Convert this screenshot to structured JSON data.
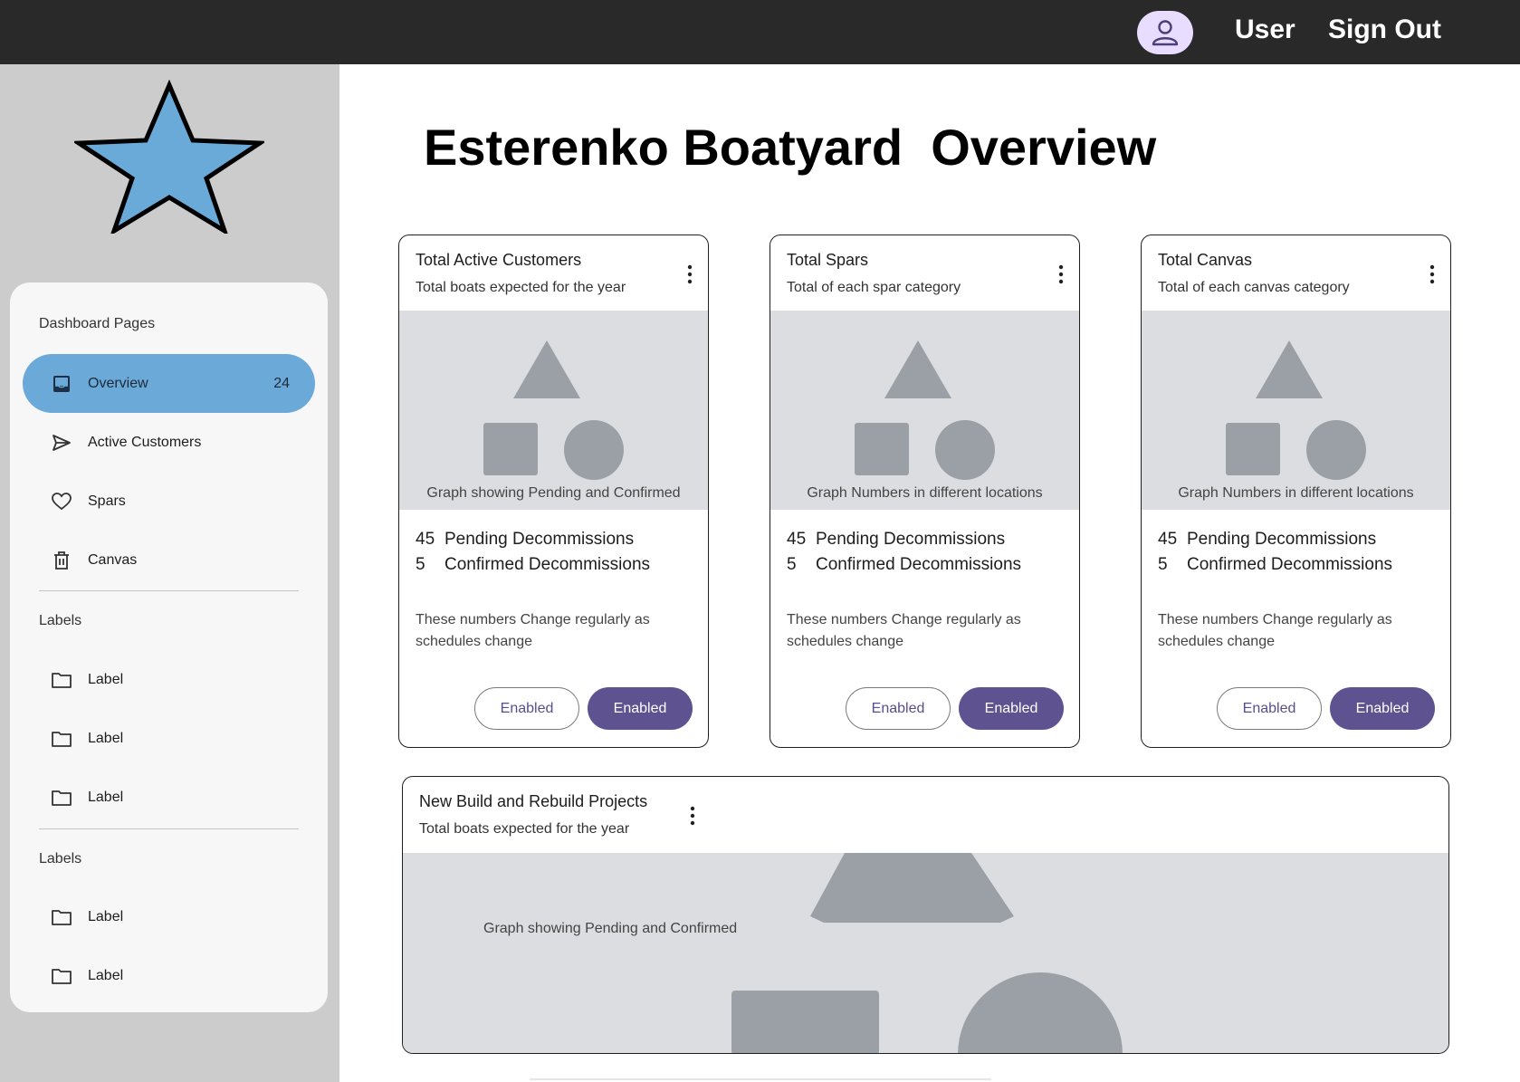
{
  "topbar": {
    "avatar_icon": "person-icon",
    "user_label": "User",
    "signout_label": "Sign Out"
  },
  "sidebar": {
    "logo_icon": "star-icon",
    "logo_color": "#6aaad8",
    "section_title": "Dashboard Pages",
    "pages": [
      {
        "label": "Overview",
        "icon": "inbox-icon",
        "badge": "24",
        "active": true
      },
      {
        "label": "Active Customers",
        "icon": "send-icon"
      },
      {
        "label": "Spars",
        "icon": "heart-icon"
      },
      {
        "label": "Canvas",
        "icon": "trash-icon"
      }
    ],
    "labels_group_1": {
      "title": "Labels",
      "items": [
        {
          "label": "Label",
          "icon": "folder-icon"
        },
        {
          "label": "Label",
          "icon": "folder-icon"
        },
        {
          "label": "Label",
          "icon": "folder-icon"
        }
      ]
    },
    "labels_group_2": {
      "title": "Labels",
      "items": [
        {
          "label": "Label",
          "icon": "folder-icon"
        },
        {
          "label": "Label",
          "icon": "folder-icon"
        }
      ]
    }
  },
  "main": {
    "title": "Esterenko Boatyard  Overview",
    "cards": [
      {
        "title": "Total Active Customers",
        "subtitle": "Total boats expected for the year",
        "media_caption": "Graph showing Pending and Confirmed",
        "stats": [
          {
            "value": "45",
            "label": "Pending Decommissions"
          },
          {
            "value": "5",
            "label": "Confirmed Decommissions"
          }
        ],
        "note": "These numbers Change regularly as schedules change",
        "button_outline": "Enabled",
        "button_filled": "Enabled"
      },
      {
        "title": "Total Spars",
        "subtitle": "Total of each spar category",
        "media_caption": "Graph Numbers in different locations",
        "stats": [
          {
            "value": "45",
            "label": "Pending Decommissions"
          },
          {
            "value": "5",
            "label": "Confirmed Decommissions"
          }
        ],
        "note": "These numbers Change regularly as schedules change",
        "button_outline": "Enabled",
        "button_filled": "Enabled"
      },
      {
        "title": "Total Canvas",
        "subtitle": "Total of each canvas category",
        "media_caption": "Graph Numbers in different locations",
        "stats": [
          {
            "value": "45",
            "label": "Pending Decommissions"
          },
          {
            "value": "5",
            "label": "Confirmed Decommissions"
          }
        ],
        "note": "These numbers Change regularly as schedules change",
        "button_outline": "Enabled",
        "button_filled": "Enabled"
      }
    ],
    "wide_card": {
      "title": "New Build and Rebuild Projects",
      "subtitle": "Total boats expected for the year",
      "media_caption": "Graph showing Pending and Confirmed"
    }
  },
  "colors": {
    "topbar": "#292929",
    "sidebar_bg": "#cccccc",
    "active_nav": "#6aa9d8",
    "primary_button": "#5f5290",
    "placeholder_bg": "#dcdde0",
    "placeholder_shape": "#9aa0a6"
  }
}
